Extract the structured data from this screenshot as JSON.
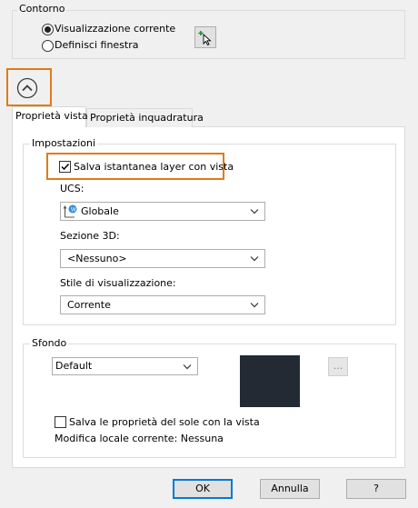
{
  "contorno": {
    "legend": "Contorno",
    "options": [
      "Visualizzazione corrente",
      "Definisci finestra"
    ],
    "selected_index": 0
  },
  "collapse_button": {
    "icon": "chevron-up-icon"
  },
  "tabs": [
    {
      "label": "Proprietà vista",
      "active": true
    },
    {
      "label": "Proprietà inquadratura",
      "active": false
    }
  ],
  "impostazioni": {
    "legend": "Impostazioni",
    "save_layer_snapshot": {
      "label": "Salva istantanea layer con vista",
      "checked": true
    },
    "ucs": {
      "label": "UCS:",
      "value": "Globale",
      "icon": "world-ucs-icon"
    },
    "sezione3d": {
      "label": "Sezione 3D:",
      "value": "<Nessuno>"
    },
    "stile": {
      "label": "Stile di visualizzazione:",
      "value": "Corrente"
    }
  },
  "sfondo": {
    "legend": "Sfondo",
    "value": "Default",
    "preview_color": "#232a33",
    "browse_label": "...",
    "save_sun": {
      "label": "Salva le proprietà del sole con la vista",
      "checked": false
    },
    "override_text": "Modifica locale corrente: Nessuna"
  },
  "footer": {
    "ok_label": "OK",
    "cancel_label": "Annulla",
    "help_label": "?"
  },
  "colors": {
    "highlight": "#e07b17",
    "ok_border": "#0078d7"
  }
}
